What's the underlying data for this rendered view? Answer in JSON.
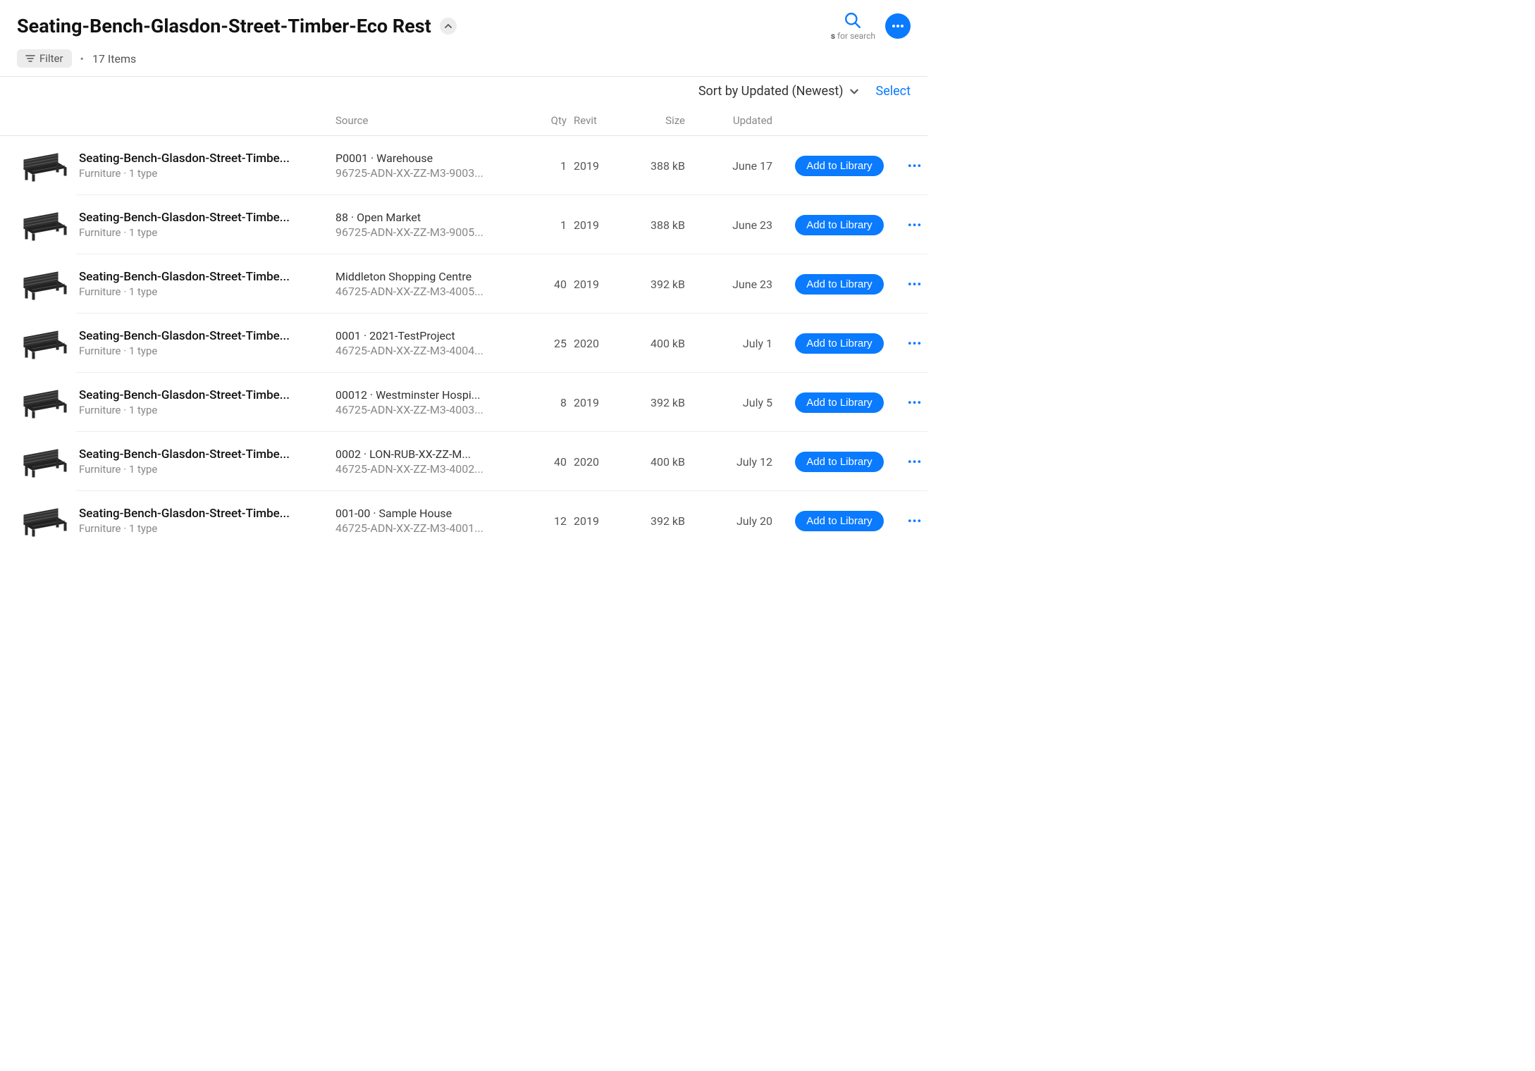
{
  "header": {
    "title": "Seating-Bench-Glasdon-Street-Timber-Eco Rest",
    "filter_label": "Filter",
    "item_count_label": "17 Items",
    "search_hint_key": "s",
    "search_hint_text": " for search"
  },
  "toolbar": {
    "sort_label": "Sort by Updated (Newest)",
    "select_label": "Select"
  },
  "columns": {
    "source": "Source",
    "qty": "Qty",
    "revit": "Revit",
    "size": "Size",
    "updated": "Updated"
  },
  "common": {
    "add_label": "Add to Library",
    "more_glyph": "•••"
  },
  "rows": [
    {
      "name": "Seating-Bench-Glasdon-Street-Timbe...",
      "meta": "Furniture  ·  1 type",
      "source_main": "P0001 · Warehouse",
      "source_sub": "96725-ADN-XX-ZZ-M3-9003...",
      "qty": "1",
      "revit": "2019",
      "size": "388 kB",
      "updated": "June 17"
    },
    {
      "name": "Seating-Bench-Glasdon-Street-Timbe...",
      "meta": "Furniture  ·  1 type",
      "source_main": "88 · Open Market",
      "source_sub": "96725-ADN-XX-ZZ-M3-9005...",
      "qty": "1",
      "revit": "2019",
      "size": "388 kB",
      "updated": "June 23"
    },
    {
      "name": "Seating-Bench-Glasdon-Street-Timbe...",
      "meta": "Furniture  ·  1 type",
      "source_main": "Middleton Shopping Centre",
      "source_sub": "46725-ADN-XX-ZZ-M3-4005...",
      "qty": "40",
      "revit": "2019",
      "size": "392 kB",
      "updated": "June 23"
    },
    {
      "name": "Seating-Bench-Glasdon-Street-Timbe...",
      "meta": "Furniture  ·  1 type",
      "source_main": "0001 · 2021-TestProject",
      "source_sub": "46725-ADN-XX-ZZ-M3-4004...",
      "qty": "25",
      "revit": "2020",
      "size": "400 kB",
      "updated": "July 1"
    },
    {
      "name": "Seating-Bench-Glasdon-Street-Timbe...",
      "meta": "Furniture  ·  1 type",
      "source_main": "00012 · Westminster Hospi...",
      "source_sub": "46725-ADN-XX-ZZ-M3-4003...",
      "qty": "8",
      "revit": "2019",
      "size": "392 kB",
      "updated": "July 5"
    },
    {
      "name": "Seating-Bench-Glasdon-Street-Timbe...",
      "meta": "Furniture  ·  1 type",
      "source_main": "0002 · LON-RUB-XX-ZZ-M...",
      "source_sub": "46725-ADN-XX-ZZ-M3-4002...",
      "qty": "40",
      "revit": "2020",
      "size": "400 kB",
      "updated": "July 12"
    },
    {
      "name": "Seating-Bench-Glasdon-Street-Timbe...",
      "meta": "Furniture  ·  1 type",
      "source_main": "001-00 · Sample House",
      "source_sub": "46725-ADN-XX-ZZ-M3-4001...",
      "qty": "12",
      "revit": "2019",
      "size": "392 kB",
      "updated": "July 20"
    }
  ]
}
